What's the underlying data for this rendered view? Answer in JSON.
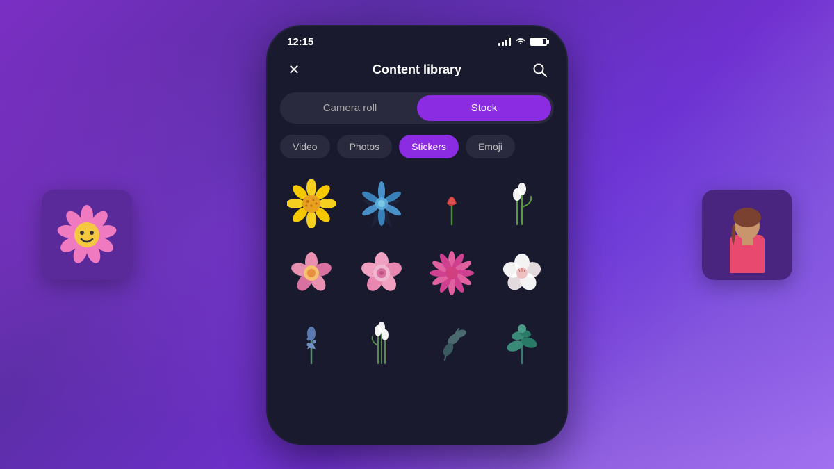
{
  "background": {
    "gradient_start": "#7b2fc4",
    "gradient_end": "#9060e0"
  },
  "status_bar": {
    "time": "12:15",
    "signal_level": 4,
    "wifi": true,
    "battery_pct": 80
  },
  "header": {
    "title": "Content library",
    "close_label": "×",
    "search_label": "🔍"
  },
  "source_toggle": {
    "options": [
      {
        "id": "camera_roll",
        "label": "Camera roll",
        "active": false
      },
      {
        "id": "stock",
        "label": "Stock",
        "active": true
      }
    ]
  },
  "category_tabs": [
    {
      "id": "video",
      "label": "Video",
      "active": false
    },
    {
      "id": "photos",
      "label": "Photos",
      "active": false
    },
    {
      "id": "stickers",
      "label": "Stickers",
      "active": true
    },
    {
      "id": "emoji",
      "label": "Emoji",
      "active": false
    }
  ],
  "stickers": [
    {
      "id": "yellow-flower",
      "desc": "Yellow daisy flower"
    },
    {
      "id": "blue-star-flower",
      "desc": "Blue star flower"
    },
    {
      "id": "red-tulip",
      "desc": "Red tulip bud"
    },
    {
      "id": "snowdrops",
      "desc": "White snowdrops"
    },
    {
      "id": "pink-flower-1",
      "desc": "Pink flower open"
    },
    {
      "id": "pink-flower-2",
      "desc": "Pink rose"
    },
    {
      "id": "pink-daisy",
      "desc": "Pink daisy"
    },
    {
      "id": "white-flower",
      "desc": "White cherry blossom"
    },
    {
      "id": "blue-spike",
      "desc": "Blue spike flower"
    },
    {
      "id": "snowdrops-2",
      "desc": "White snowdrops group"
    },
    {
      "id": "dark-leaf",
      "desc": "Dark leaf branch"
    },
    {
      "id": "teal-plant",
      "desc": "Teal plant"
    }
  ],
  "left_card": {
    "desc": "Smiley flower sticker"
  },
  "right_card": {
    "desc": "Person silhouette"
  }
}
